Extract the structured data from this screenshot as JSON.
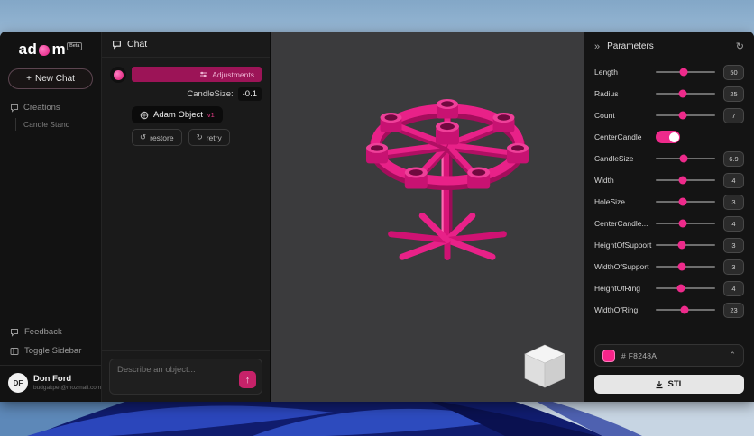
{
  "brand": {
    "logo_left": "ad",
    "logo_right": "m",
    "beta_badge": "Beta"
  },
  "icons": {
    "plus": "+",
    "chevrons_right": "»",
    "refresh": "↻",
    "send": "↑",
    "chevron_up": "⌃",
    "restore_arrow": "↺",
    "retry_arrow": "↻"
  },
  "sidebar": {
    "new_chat_label": "New Chat",
    "creations_label": "Creations",
    "creations_items": [
      {
        "label": "Candle Stand"
      }
    ],
    "feedback_label": "Feedback",
    "toggle_sidebar_label": "Toggle Sidebar",
    "user": {
      "initials": "DF",
      "name": "Don Ford",
      "email": "budgakpet@mozmail.com"
    }
  },
  "chat": {
    "header": "Chat",
    "message": {
      "adjustments_label": "Adjustments",
      "param_label": "CandleSize:",
      "param_value": "-0.1",
      "object_label": "Adam Object",
      "object_version": "v1",
      "restore_label": "restore",
      "retry_label": "retry"
    },
    "input_placeholder": "Describe an object..."
  },
  "parameters": {
    "title": "Parameters",
    "sliders": [
      {
        "label": "Length",
        "value": "50",
        "pct": 47
      },
      {
        "label": "Radius",
        "value": "25",
        "pct": 46
      },
      {
        "label": "Count",
        "value": "7",
        "pct": 46
      },
      {
        "label": "CandleSize",
        "value": "6.9",
        "pct": 47
      },
      {
        "label": "Width",
        "value": "4",
        "pct": 46
      },
      {
        "label": "HoleSize",
        "value": "3",
        "pct": 46
      },
      {
        "label": "CenterCandle...",
        "value": "4",
        "pct": 45
      },
      {
        "label": "HeightOfSupport",
        "value": "3",
        "pct": 44
      },
      {
        "label": "WidthOfSupport",
        "value": "3",
        "pct": 44
      },
      {
        "label": "HeightOfRing",
        "value": "4",
        "pct": 43
      },
      {
        "label": "WidthOfRing",
        "value": "23",
        "pct": 48
      }
    ],
    "toggle": {
      "label": "CenterCandle",
      "state": "on"
    },
    "color": {
      "hex_label": "# F8248A",
      "swatch": "#F8248A"
    },
    "export_label": "STL"
  },
  "colors": {
    "accent": "#F8248A",
    "model_pink": "#E8218B",
    "adjustments_bar": "#9C1457"
  }
}
